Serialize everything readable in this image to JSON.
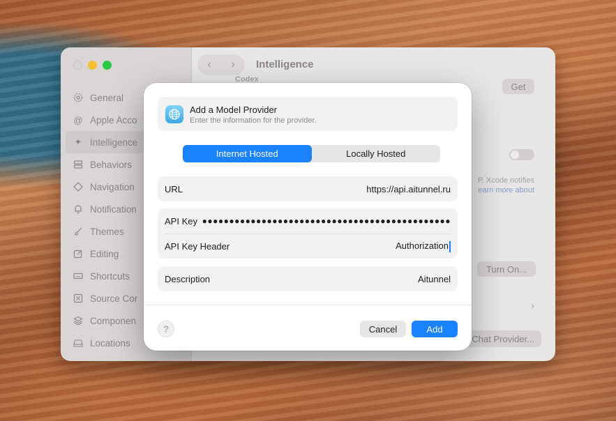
{
  "settings_window": {
    "title": "Intelligence",
    "faded_subtitle": "Codex",
    "get_button": "Get",
    "notify_text_1": "P. Xcode notifies",
    "notify_text_2": "earn more about",
    "turn_on_button": "Turn On...",
    "chat_provider_button": "Chat Provider...",
    "sidebar": {
      "items": [
        {
          "label": "General",
          "icon": "gear-icon"
        },
        {
          "label": "Apple Acco",
          "icon": "at-icon"
        },
        {
          "label": "Intelligence",
          "icon": "sparkles-icon",
          "active": true
        },
        {
          "label": "Behaviors",
          "icon": "behaviors-icon"
        },
        {
          "label": "Navigation",
          "icon": "navigation-icon"
        },
        {
          "label": "Notification",
          "icon": "bell-icon"
        },
        {
          "label": "Themes",
          "icon": "brush-icon"
        },
        {
          "label": "Editing",
          "icon": "edit-icon"
        },
        {
          "label": "Shortcuts",
          "icon": "keyboard-icon"
        },
        {
          "label": "Source Cor",
          "icon": "source-control-icon"
        },
        {
          "label": "Componen",
          "icon": "components-icon"
        },
        {
          "label": "Locations",
          "icon": "drive-icon"
        }
      ]
    }
  },
  "modal": {
    "title": "Add a Model Provider",
    "subtitle": "Enter the information for the provider.",
    "icon": "globe-icon",
    "tabs": [
      {
        "label": "Internet Hosted",
        "active": true
      },
      {
        "label": "Locally Hosted",
        "active": false
      }
    ],
    "fields": {
      "url": {
        "label": "URL",
        "value": "https://api.aitunnel.ru"
      },
      "api_key": {
        "label": "API Key",
        "value": "●●●●●●●●●●●●●●●●●●●●●●●●●●●●●●●●●●●●●●●●●●●●●●"
      },
      "api_key_header": {
        "label": "API Key Header",
        "value": "Authorization"
      },
      "description": {
        "label": "Description",
        "value": "Aitunnel"
      }
    },
    "help_button": "?",
    "cancel_button": "Cancel",
    "add_button": "Add"
  },
  "colors": {
    "accent": "#1a82fb",
    "field_bg": "#f2f2f2"
  }
}
